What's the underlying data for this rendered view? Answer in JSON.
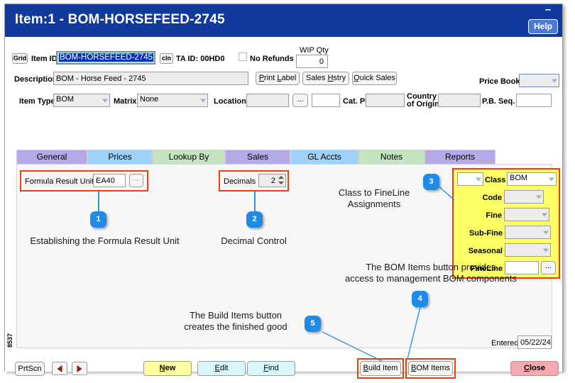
{
  "window": {
    "title": "Item:1 - BOM-HORSEFEED-2745",
    "minimize": "–",
    "help_label": "Help"
  },
  "toolbar": {
    "grid_label": "Grid",
    "item_id_label": "Item ID",
    "item_id_value": "BOM-HORSEFEED-2745",
    "cln_label": "cln",
    "ta_id_label": "TA ID: 00HD0",
    "no_refunds_label": "No Refunds",
    "wip_qty_label": "WIP Qty",
    "wip_qty_value": "0"
  },
  "description": {
    "label": "Description",
    "value": "BOM - Horse Feed - 2745",
    "print_label": "Print Label",
    "sales_hstry": "Sales Hstry",
    "quick_sales": "Quick Sales",
    "price_book_label": "Price Book",
    "price_book_value": ""
  },
  "row3": {
    "item_type_label": "Item Type",
    "item_type_value": "BOM",
    "matrix_label": "Matrix",
    "matrix_value": "None",
    "location_label": "Location",
    "location_value": "",
    "ellipsis": "...",
    "location_extra_value": "",
    "cat_pg_label": "Cat. Pg.",
    "cat_pg_value": "",
    "country_label_line1": "Country",
    "country_label_line2": "of Origin",
    "country_value": "",
    "pb_seq_label": "P.B. Seq.",
    "pb_seq_value": ""
  },
  "tabs": [
    {
      "label": "General",
      "color": "purple"
    },
    {
      "label": "Prices",
      "color": "blue"
    },
    {
      "label": "Lookup By",
      "color": "green"
    },
    {
      "label": "Sales",
      "color": "purple"
    },
    {
      "label": "GL Accts",
      "color": "blue"
    },
    {
      "label": "Notes",
      "color": "green"
    },
    {
      "label": "Reports",
      "color": "purple"
    }
  ],
  "general_tab": {
    "formula_result_unit_label": "Formula Result Unit",
    "formula_result_unit_value": "EA40",
    "formula_ellipsis": "...",
    "decimals_label": "Decimals",
    "decimals_value": "2",
    "entered_label": "Entered",
    "entered_value": "05/22/24"
  },
  "class_panel": {
    "prefix_value": "",
    "class_label": "Class",
    "class_value": "BOM",
    "code_label": "Code",
    "code_value": "",
    "fine_label": "Fine",
    "fine_value": "",
    "subfine_label": "Sub-Fine",
    "subfine_value": "",
    "seasonal_label": "Seasonal",
    "seasonal_value": "",
    "fineline_label": "FineLine",
    "fineline_value": "",
    "fineline_ellipsis": "..."
  },
  "annotations": {
    "note1": "Establishing the Formula Result Unit",
    "badge1": "1",
    "note2": "Decimal Control",
    "badge2": "2",
    "note3": "Class to FineLine\nAssignments",
    "badge3": "3",
    "note4": "The BOM Items button provides\naccess to management BOM components",
    "badge4": "4",
    "note5": "The Build Items button\ncreates the finished good",
    "badge5": "5"
  },
  "footer": {
    "prtscn_label": "PrtScn",
    "prev_icon": "left-arrow-icon",
    "next_icon": "right-arrow-icon",
    "new_label": "New",
    "edit_label": "Edit",
    "find_label": "Find",
    "build_item_label": "Build Item",
    "bom_items_label": "BOM Items",
    "close_label": "Close"
  },
  "side_code": "8537",
  "colors": {
    "titlebar": "#123a9c",
    "accent_red": "#e8400c",
    "callout_blue": "#1f8ae8",
    "highlight_yellow": "#ffff66",
    "id_field": "#9ff7f7"
  }
}
